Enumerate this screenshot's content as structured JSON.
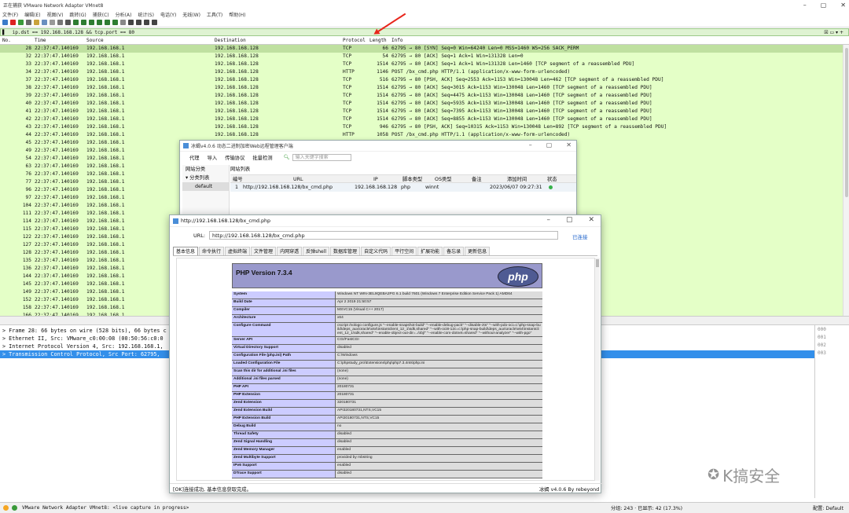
{
  "wireshark": {
    "title": "正在捕获 VMware Network Adapter VMnet8",
    "menu": [
      "文件(F)",
      "编辑(E)",
      "视图(V)",
      "跳转(G)",
      "捕获(C)",
      "分析(A)",
      "统计(S)",
      "电话(Y)",
      "无线(W)",
      "工具(T)",
      "帮助(H)"
    ],
    "filter": "ip.dst == 192.168.168.128 && tcp.port == 80",
    "columns": [
      "No.",
      "Time",
      "Source",
      "Destination",
      "Protocol",
      "Length",
      "Info"
    ],
    "packets": [
      {
        "no": "28",
        "time": "22:37:47.140169",
        "src": "192.168.168.1",
        "dst": "192.168.168.128",
        "proto": "TCP",
        "len": "66",
        "info": "62795 → 80 [SYN] Seq=0 Win=64240 Len=0 MSS=1460 WS=256 SACK_PERM"
      },
      {
        "no": "32",
        "time": "22:37:47.140169",
        "src": "192.168.168.1",
        "dst": "192.168.168.128",
        "proto": "TCP",
        "len": "54",
        "info": "62795 → 80 [ACK] Seq=1 Ack=1 Win=131328 Len=0"
      },
      {
        "no": "33",
        "time": "22:37:47.140169",
        "src": "192.168.168.1",
        "dst": "192.168.168.128",
        "proto": "TCP",
        "len": "1514",
        "info": "62795 → 80 [ACK] Seq=1 Ack=1 Win=131328 Len=1460 [TCP segment of a reassembled PDU]"
      },
      {
        "no": "34",
        "time": "22:37:47.140169",
        "src": "192.168.168.1",
        "dst": "192.168.168.128",
        "proto": "HTTP",
        "len": "1146",
        "info": "POST /bx_cmd.php HTTP/1.1  (application/x-www-form-urlencoded)"
      },
      {
        "no": "37",
        "time": "22:37:47.140169",
        "src": "192.168.168.1",
        "dst": "192.168.168.128",
        "proto": "TCP",
        "len": "516",
        "info": "62795 → 80 [PSH, ACK] Seq=2553 Ack=1153 Win=130048 Len=462 [TCP segment of a reassembled PDU]"
      },
      {
        "no": "38",
        "time": "22:37:47.140169",
        "src": "192.168.168.1",
        "dst": "192.168.168.128",
        "proto": "TCP",
        "len": "1514",
        "info": "62795 → 80 [ACK] Seq=3015 Ack=1153 Win=130048 Len=1460 [TCP segment of a reassembled PDU]"
      },
      {
        "no": "39",
        "time": "22:37:47.140169",
        "src": "192.168.168.1",
        "dst": "192.168.168.128",
        "proto": "TCP",
        "len": "1514",
        "info": "62795 → 80 [ACK] Seq=4475 Ack=1153 Win=130048 Len=1460 [TCP segment of a reassembled PDU]"
      },
      {
        "no": "40",
        "time": "22:37:47.140169",
        "src": "192.168.168.1",
        "dst": "192.168.168.128",
        "proto": "TCP",
        "len": "1514",
        "info": "62795 → 80 [ACK] Seq=5935 Ack=1153 Win=130048 Len=1460 [TCP segment of a reassembled PDU]"
      },
      {
        "no": "41",
        "time": "22:37:47.140169",
        "src": "192.168.168.1",
        "dst": "192.168.168.128",
        "proto": "TCP",
        "len": "1514",
        "info": "62795 → 80 [ACK] Seq=7395 Ack=1153 Win=130048 Len=1460 [TCP segment of a reassembled PDU]"
      },
      {
        "no": "42",
        "time": "22:37:47.140169",
        "src": "192.168.168.1",
        "dst": "192.168.168.128",
        "proto": "TCP",
        "len": "1514",
        "info": "62795 → 80 [ACK] Seq=8855 Ack=1153 Win=130048 Len=1460 [TCP segment of a reassembled PDU]"
      },
      {
        "no": "43",
        "time": "22:37:47.140169",
        "src": "192.168.168.1",
        "dst": "192.168.168.128",
        "proto": "TCP",
        "len": "946",
        "info": "62795 → 80 [PSH, ACK] Seq=10315 Ack=1153 Win=130048 Len=892 [TCP segment of a reassembled PDU]"
      },
      {
        "no": "44",
        "time": "22:37:47.140169",
        "src": "192.168.168.1",
        "dst": "192.168.168.128",
        "proto": "HTTP",
        "len": "1058",
        "info": "POST /bx_cmd.php HTTP/1.1  (application/x-www-form-urlencoded)"
      },
      {
        "no": "45",
        "time": "22:37:47.140169",
        "src": "192.168.168.1",
        "dst": "192.168.168.128",
        "proto": "",
        "len": "",
        "info": ""
      },
      {
        "no": "49",
        "time": "22:37:47.140169",
        "src": "192.168.168.1",
        "dst": "",
        "proto": "",
        "len": "",
        "info": ""
      },
      {
        "no": "54",
        "time": "22:37:47.140169",
        "src": "192.168.168.1",
        "dst": "",
        "proto": "",
        "len": "",
        "info": ""
      },
      {
        "no": "63",
        "time": "22:37:47.140169",
        "src": "192.168.168.1",
        "dst": "",
        "proto": "",
        "len": "",
        "info": ""
      },
      {
        "no": "76",
        "time": "22:37:47.140169",
        "src": "192.168.168.1",
        "dst": "",
        "proto": "",
        "len": "",
        "info": ""
      },
      {
        "no": "77",
        "time": "22:37:47.140169",
        "src": "192.168.168.1",
        "dst": "",
        "proto": "",
        "len": "",
        "info": ""
      },
      {
        "no": "96",
        "time": "22:37:47.140169",
        "src": "192.168.168.1",
        "dst": "",
        "proto": "",
        "len": "",
        "info": ""
      },
      {
        "no": "97",
        "time": "22:37:47.140169",
        "src": "192.168.168.1",
        "dst": "",
        "proto": "",
        "len": "",
        "info": ""
      },
      {
        "no": "104",
        "time": "22:37:47.140169",
        "src": "192.168.168.1",
        "dst": "",
        "proto": "",
        "len": "",
        "info": ""
      },
      {
        "no": "111",
        "time": "22:37:47.140169",
        "src": "192.168.168.1",
        "dst": "",
        "proto": "",
        "len": "",
        "info": ""
      },
      {
        "no": "114",
        "time": "22:37:47.140169",
        "src": "192.168.168.1",
        "dst": "",
        "proto": "",
        "len": "",
        "info": ""
      },
      {
        "no": "115",
        "time": "22:37:47.140169",
        "src": "192.168.168.1",
        "dst": "",
        "proto": "",
        "len": "",
        "info": ""
      },
      {
        "no": "122",
        "time": "22:37:47.140169",
        "src": "192.168.168.1",
        "dst": "",
        "proto": "",
        "len": "",
        "info": ""
      },
      {
        "no": "127",
        "time": "22:37:47.140169",
        "src": "192.168.168.1",
        "dst": "",
        "proto": "",
        "len": "",
        "info": ""
      },
      {
        "no": "128",
        "time": "22:37:47.140169",
        "src": "192.168.168.1",
        "dst": "",
        "proto": "",
        "len": "",
        "info": ""
      },
      {
        "no": "135",
        "time": "22:37:47.140169",
        "src": "192.168.168.1",
        "dst": "",
        "proto": "",
        "len": "",
        "info": ""
      },
      {
        "no": "136",
        "time": "22:37:47.140169",
        "src": "192.168.168.1",
        "dst": "",
        "proto": "",
        "len": "",
        "info": ""
      },
      {
        "no": "144",
        "time": "22:37:47.140169",
        "src": "192.168.168.1",
        "dst": "",
        "proto": "",
        "len": "",
        "info": ""
      },
      {
        "no": "145",
        "time": "22:37:47.140169",
        "src": "192.168.168.1",
        "dst": "",
        "proto": "",
        "len": "",
        "info": ""
      },
      {
        "no": "149",
        "time": "22:37:47.140169",
        "src": "192.168.168.1",
        "dst": "",
        "proto": "",
        "len": "",
        "info": ""
      },
      {
        "no": "152",
        "time": "22:37:47.140169",
        "src": "192.168.168.1",
        "dst": "",
        "proto": "",
        "len": "",
        "info": ""
      },
      {
        "no": "158",
        "time": "22:37:47.140169",
        "src": "192.168.168.1",
        "dst": "",
        "proto": "",
        "len": "",
        "info": ""
      },
      {
        "no": "166",
        "time": "22:37:47.140169",
        "src": "192.168.168.1",
        "dst": "",
        "proto": "",
        "len": "",
        "info": ""
      },
      {
        "no": "169",
        "time": "22:37:47.140169",
        "src": "192.168.168.1",
        "dst": "",
        "proto": "",
        "len": "",
        "info": ""
      },
      {
        "no": "173",
        "time": "22:37:47.140169",
        "src": "192.168.168.1",
        "dst": "",
        "proto": "",
        "len": "",
        "info": ""
      }
    ],
    "details": [
      "> Frame 28: 66 bytes on wire (528 bits), 66 bytes c",
      "> Ethernet II, Src: VMware_c0:00:08 (00:50:56:c0:0",
      "> Internet Protocol Version 4, Src: 192.168.168.1,",
      "> Transmission Control Protocol, Src Port: 62795,"
    ],
    "hex": [
      "000",
      "001",
      "002",
      "003"
    ],
    "status": {
      "adapter": "VMware Network Adapter VMnet8: <live capture in progress>",
      "packets": "分组: 243 · 已显示: 42 (17.3%)",
      "profile": "配置: Default"
    }
  },
  "antsword": {
    "title": "冰蝎v4.0.6 动态二进制加密Web远程管理客户端",
    "menu": [
      "代理",
      "导入",
      "传输协议",
      "批量检测"
    ],
    "search_placeholder": "输入关键字搜索",
    "left_header": "网站分类",
    "left_items": [
      "分类列表",
      "default"
    ],
    "right_header": "网站列表",
    "columns": [
      "编号",
      "URL",
      "IP",
      "脚本类型",
      "OS类型",
      "备注",
      "添加时间",
      "状态"
    ],
    "row": {
      "id": "1",
      "url": "http://192.168.168.128/bx_cmd.php",
      "ip": "192.168.168.128",
      "type": "php",
      "os": "winnt",
      "note": "",
      "time": "2023/06/07 09:27:31"
    }
  },
  "shell": {
    "title": "http://192.168.168.128/bx_cmd.php",
    "url_label": "URL:",
    "url": "http://192.168.168.128/bx_cmd.php",
    "connected": "已连接",
    "tabs": [
      "基本信息",
      "命令执行",
      "虚拟终端",
      "文件管理",
      "内网穿透",
      "反弹shell",
      "数据库管理",
      "自定义代码",
      "平行空间",
      "扩展功能",
      "备忘录",
      "更新信息"
    ],
    "php_version": "PHP Version 7.3.4",
    "php_logo": "php",
    "phpinfo": [
      {
        "k": "System",
        "v": "Windows NT WIN-3EL9QEBA2PG 6.1 build 7601 (Windows 7 Enterprise Edition Service Pack 1) AMD64"
      },
      {
        "k": "Build Date",
        "v": "Apr 2 2019 21:50:57"
      },
      {
        "k": "Compiler",
        "v": "MSVC15 (Visual C++ 2017)"
      },
      {
        "k": "Architecture",
        "v": "x64"
      },
      {
        "k": "Configure Command",
        "v": "cscript /nologo configure.js \"--enable-snapshot-build\" \"--enable-debug-pack\" \"--disable-zts\" \"--with-pdo-oci=c:\\php-snap-build\\deps_aux\\oracle\\x64\\instantclient_12_1\\sdk,shared\" \"--with-oci8-12c=c:\\php-snap-build\\deps_aux\\oracle\\x64\\instantclient_12_1\\sdk,shared\" \"--enable-object-out-dir=../obj/\" \"--enable-com-dotnet=shared\" \"--without-analyzer\" \"--with-pgo\""
      },
      {
        "k": "Server API",
        "v": "CGI/FastCGI"
      },
      {
        "k": "Virtual Directory Support",
        "v": "disabled"
      },
      {
        "k": "Configuration File (php.ini) Path",
        "v": "C:\\Windows"
      },
      {
        "k": "Loaded Configuration File",
        "v": "C:\\phpstudy_pro\\Extensions\\php\\php7.3.4nts\\php.ini"
      },
      {
        "k": "Scan this dir for additional .ini files",
        "v": "(none)"
      },
      {
        "k": "Additional .ini files parsed",
        "v": "(none)"
      },
      {
        "k": "PHP API",
        "v": "20180731"
      },
      {
        "k": "PHP Extension",
        "v": "20180731"
      },
      {
        "k": "Zend Extension",
        "v": "320180731"
      },
      {
        "k": "Zend Extension Build",
        "v": "API320180731,NTS,VC15"
      },
      {
        "k": "PHP Extension Build",
        "v": "API20180731,NTS,VC15"
      },
      {
        "k": "Debug Build",
        "v": "no"
      },
      {
        "k": "Thread Safety",
        "v": "disabled"
      },
      {
        "k": "Zend Signal Handling",
        "v": "disabled"
      },
      {
        "k": "Zend Memory Manager",
        "v": "enabled"
      },
      {
        "k": "Zend Multibyte Support",
        "v": "provided by mbstring"
      },
      {
        "k": "IPv6 Support",
        "v": "enabled"
      },
      {
        "k": "DTrace Support",
        "v": "disabled"
      }
    ],
    "status_left": "[OK]连接成功, 基本信息获取完成。",
    "status_right": "冰蝎 v4.0.6    By rebeyond"
  },
  "watermark": "K搞安全",
  "colors": {
    "packet_bg": "#e4ffc7",
    "selected_detail": "#338fea",
    "arrow": "#e8261c",
    "php_header": "#9999cc"
  }
}
